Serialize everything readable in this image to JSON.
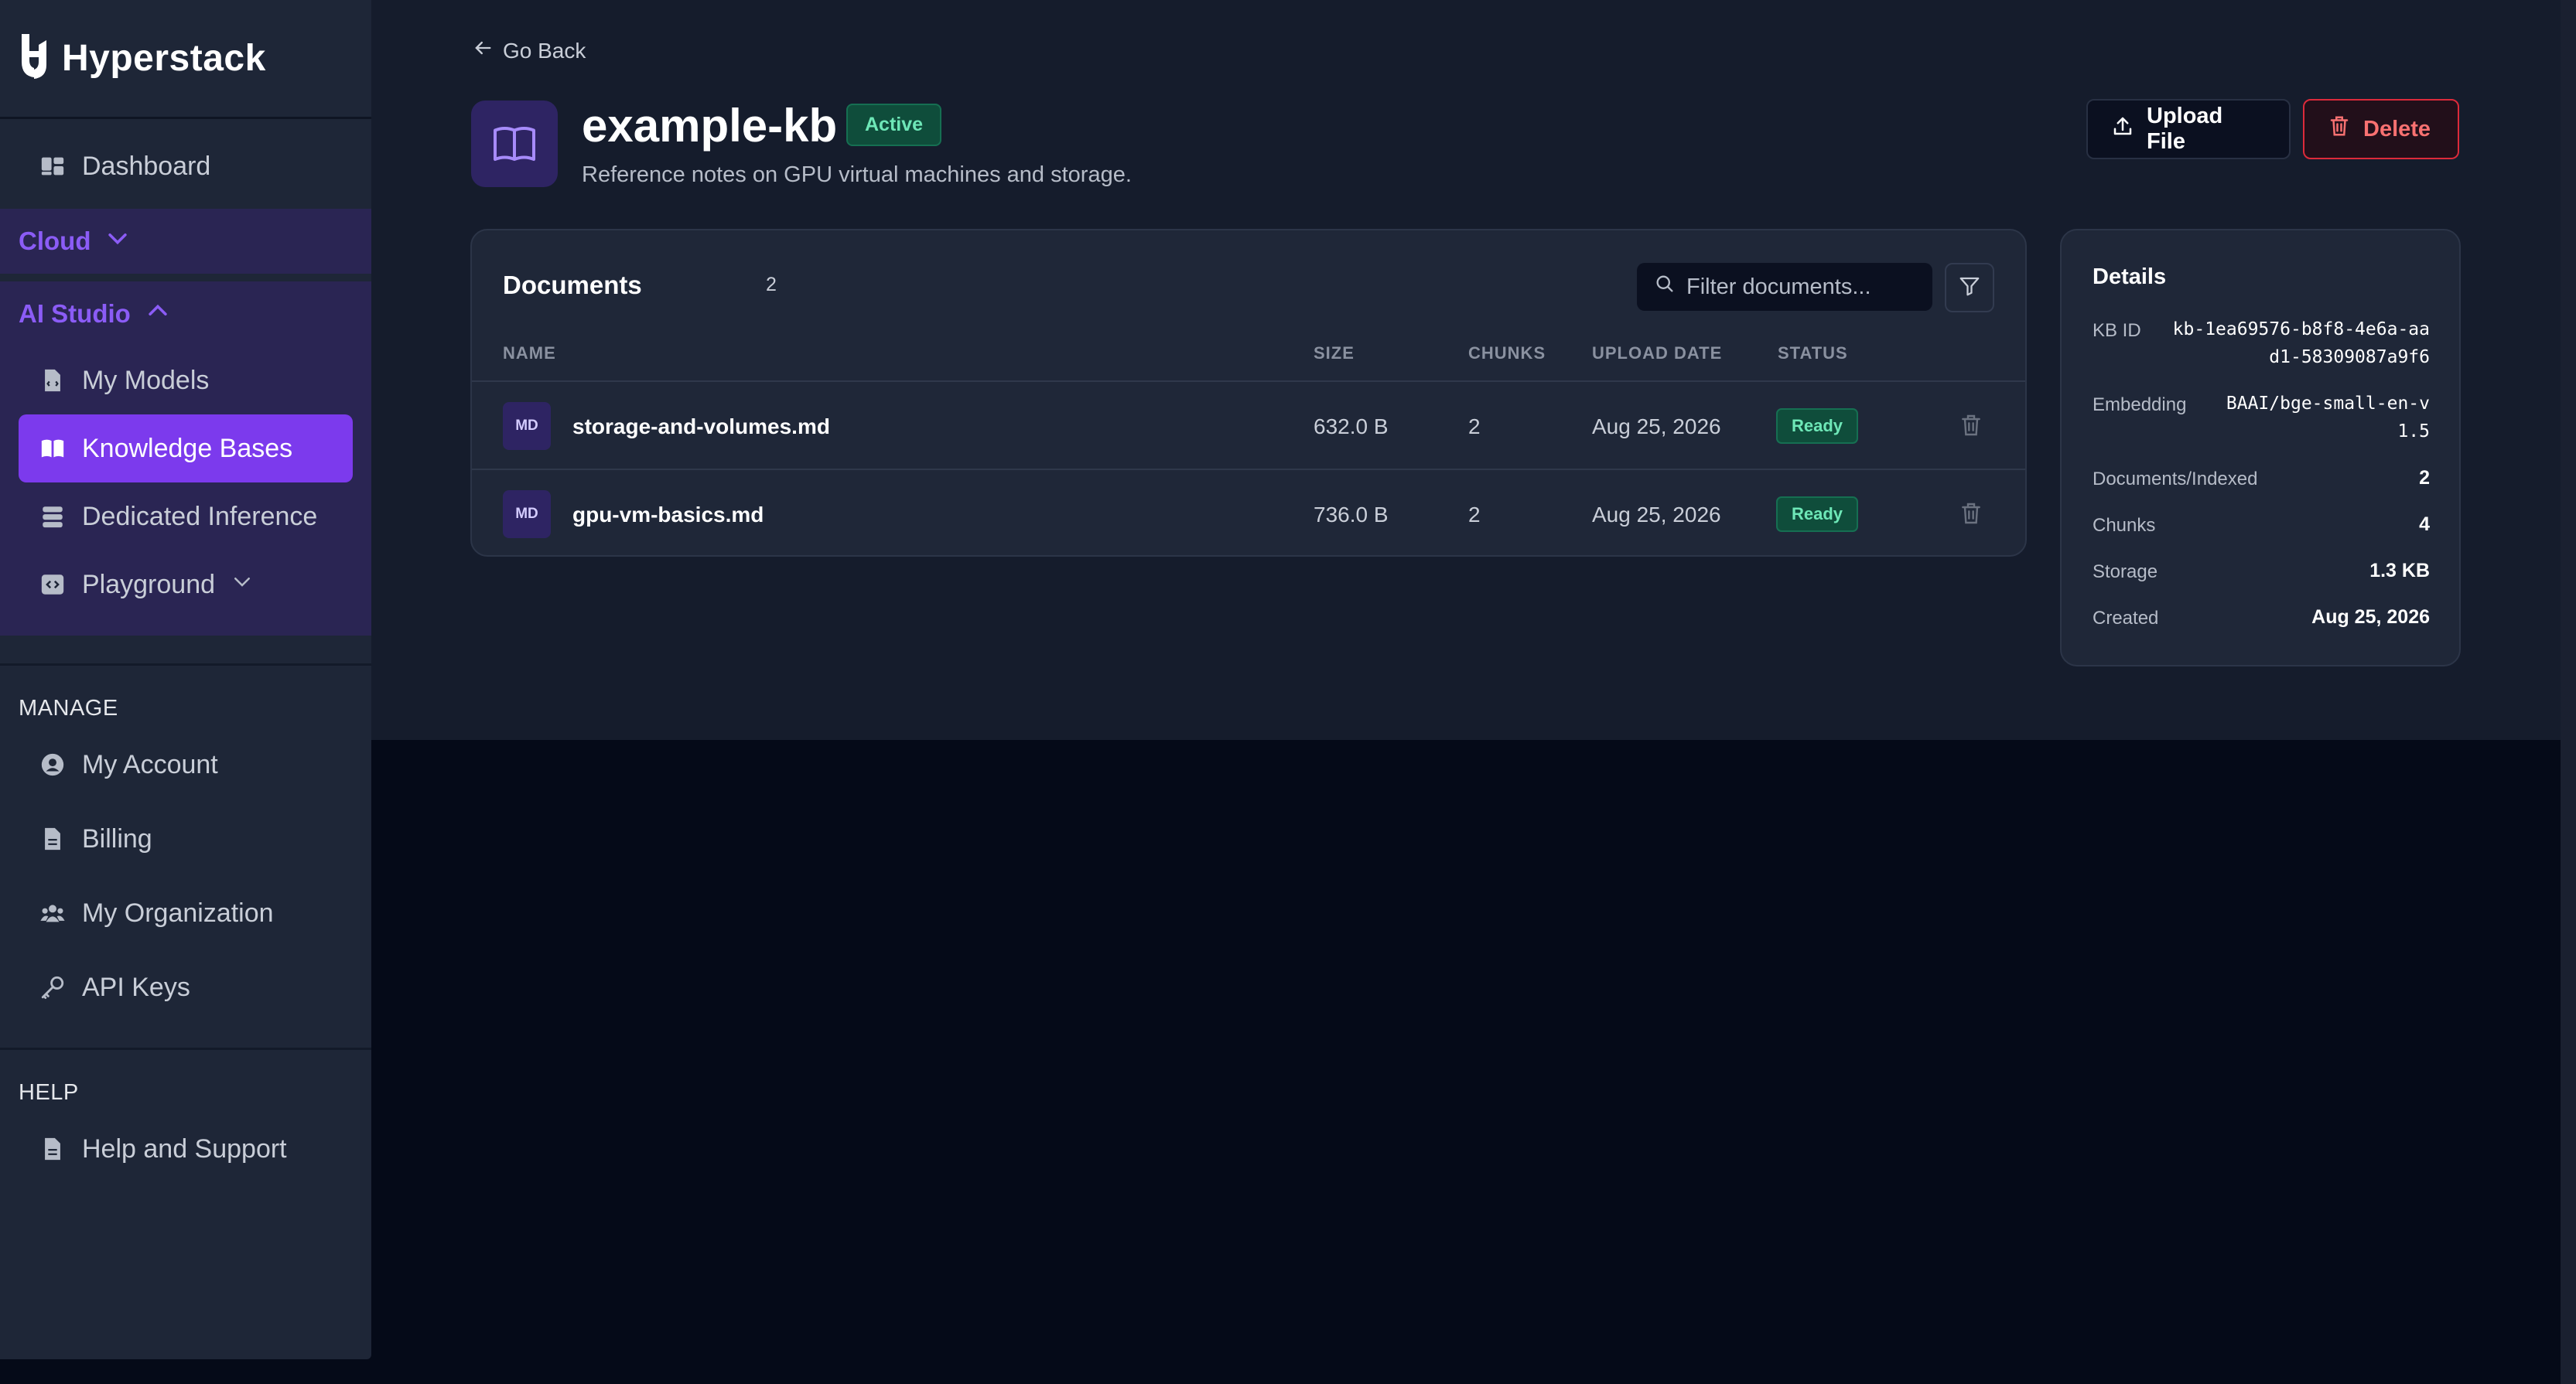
{
  "app": {
    "brand": "Hyperstack"
  },
  "sidebar": {
    "dashboard": "Dashboard",
    "cloud": "Cloud",
    "ai_studio": "AI Studio",
    "ai_items": [
      "My Models",
      "Knowledge Bases",
      "Dedicated Inference",
      "Playground"
    ],
    "manage_label": "MANAGE",
    "manage_items": [
      "My Account",
      "Billing",
      "My Organization",
      "API Keys"
    ],
    "help_label": "HELP",
    "help_items": [
      "Help and Support"
    ]
  },
  "header": {
    "go_back": "Go Back",
    "title": "example-kb",
    "status": "Active",
    "description": "Reference notes on GPU virtual machines and storage.",
    "upload_label": "Upload File",
    "delete_label": "Delete"
  },
  "documents": {
    "title": "Documents",
    "count": "2",
    "filter_placeholder": "Filter documents...",
    "columns": [
      "NAME",
      "SIZE",
      "CHUNKS",
      "UPLOAD DATE",
      "STATUS"
    ],
    "rows": [
      {
        "type": "MD",
        "name": "storage-and-volumes.md",
        "size": "632.0 B",
        "chunks": "2",
        "date": "Aug 25, 2026",
        "status": "Ready"
      },
      {
        "type": "MD",
        "name": "gpu-vm-basics.md",
        "size": "736.0 B",
        "chunks": "2",
        "date": "Aug 25, 2026",
        "status": "Ready"
      }
    ]
  },
  "details": {
    "title": "Details",
    "kb_id_label": "KB ID",
    "kb_id_line1": "kb-1ea69576-b8f8-4e6a-aa",
    "kb_id_line2": "d1-58309087a9f6",
    "embedding_label": "Embedding",
    "embedding_line1": "BAAI/bge-small-en-v",
    "embedding_line2": "1.5",
    "docs_label": "Documents/Indexed",
    "docs_value": "2",
    "chunks_label": "Chunks",
    "chunks_value": "4",
    "storage_label": "Storage",
    "storage_value": "1.3 KB",
    "created_label": "Created",
    "created_value": "Aug 25, 2026"
  },
  "colors": {
    "accent": "#7c3aed",
    "success": "#6ee7b7",
    "danger": "#dc2a3a"
  }
}
